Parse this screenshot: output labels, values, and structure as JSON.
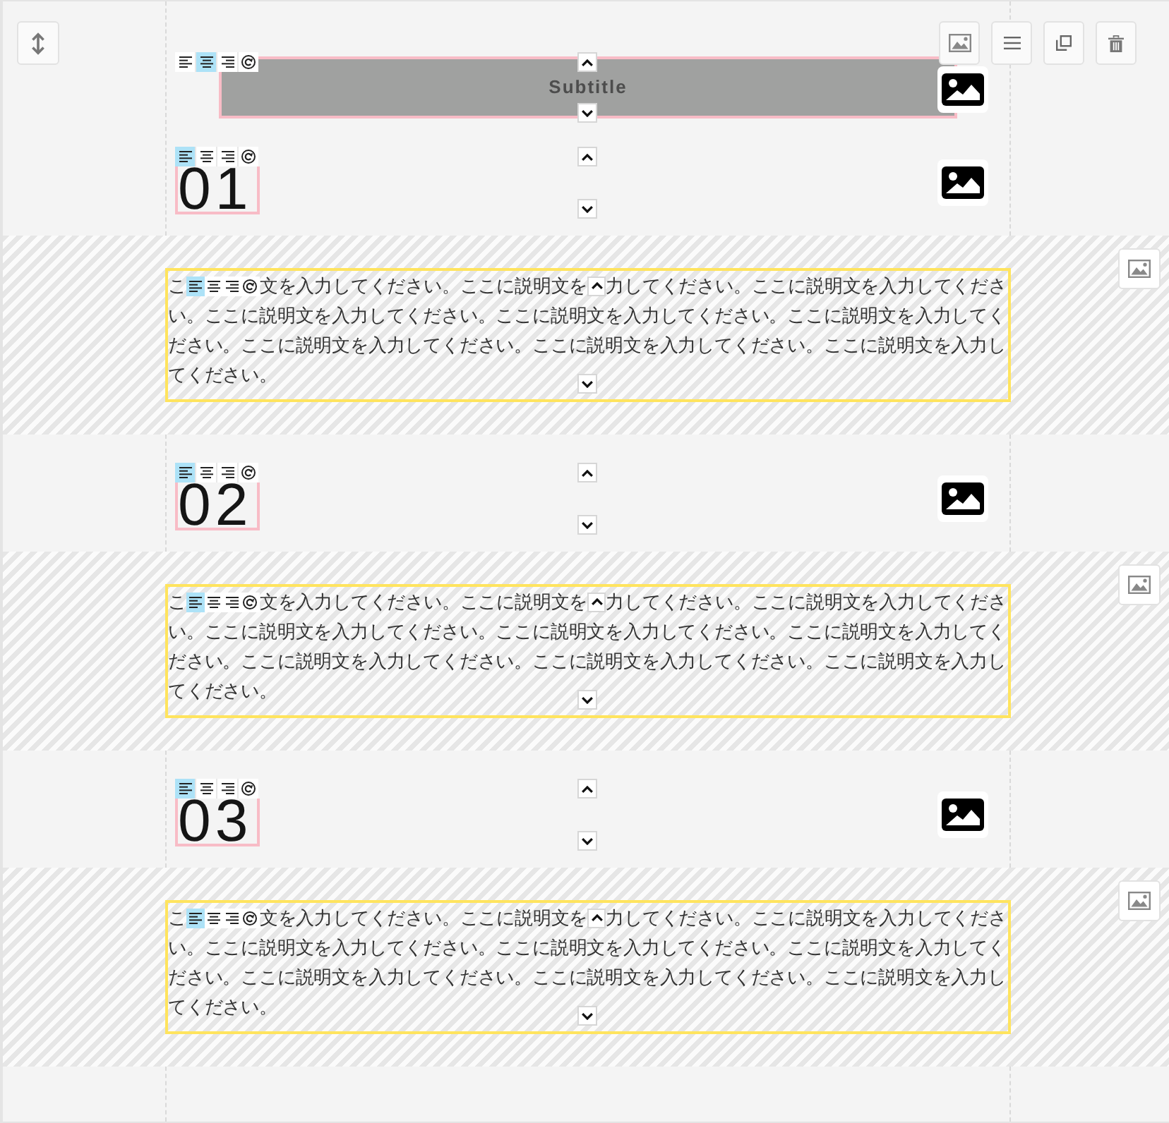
{
  "blocks": [
    {
      "kind": "subtitle",
      "text": "Subtitle",
      "align_options": [
        {
          "kind": "left",
          "selected": false
        },
        {
          "kind": "center",
          "selected": true
        },
        {
          "kind": "right",
          "selected": false
        },
        {
          "kind": "reset",
          "selected": false
        }
      ]
    },
    {
      "kind": "number",
      "text": "01",
      "align_options": [
        {
          "kind": "left",
          "selected": true
        },
        {
          "kind": "center",
          "selected": false
        },
        {
          "kind": "right",
          "selected": false
        },
        {
          "kind": "reset",
          "selected": false
        }
      ]
    },
    {
      "kind": "description",
      "first_line_parts": [
        "こ",
        "文を入力してください。ここに説明文を",
        "力してください。ここに説明文を入力してくださ"
      ],
      "more_lines": [
        "い。ここに説明文を入力してください。ここに説明文を入力してください。ここに説明文を入力してく",
        "ださい。ここに説明文を入力してください。ここに説明文を入力してください。ここに説明文を入力し",
        "てください。"
      ],
      "align_options": [
        {
          "kind": "left",
          "selected": true
        },
        {
          "kind": "center",
          "selected": false
        },
        {
          "kind": "right",
          "selected": false
        },
        {
          "kind": "reset",
          "selected": false
        }
      ]
    },
    {
      "kind": "number",
      "text": "02",
      "align_options": [
        {
          "kind": "left",
          "selected": true
        },
        {
          "kind": "center",
          "selected": false
        },
        {
          "kind": "right",
          "selected": false
        },
        {
          "kind": "reset",
          "selected": false
        }
      ]
    },
    {
      "kind": "description",
      "first_line_parts": [
        "こ",
        "文を入力してください。ここに説明文を",
        "力してください。ここに説明文を入力してくださ"
      ],
      "more_lines": [
        "い。ここに説明文を入力してください。ここに説明文を入力してください。ここに説明文を入力してく",
        "ださい。ここに説明文を入力してください。ここに説明文を入力してください。ここに説明文を入力し",
        "てください。"
      ],
      "align_options": [
        {
          "kind": "left",
          "selected": true
        },
        {
          "kind": "center",
          "selected": false
        },
        {
          "kind": "right",
          "selected": false
        },
        {
          "kind": "reset",
          "selected": false
        }
      ]
    },
    {
      "kind": "number",
      "text": "03",
      "align_options": [
        {
          "kind": "left",
          "selected": true
        },
        {
          "kind": "center",
          "selected": false
        },
        {
          "kind": "right",
          "selected": false
        },
        {
          "kind": "reset",
          "selected": false
        }
      ]
    },
    {
      "kind": "description",
      "first_line_parts": [
        "こ",
        "文を入力してください。ここに説明文を",
        "力してください。ここに説明文を入力してくださ"
      ],
      "more_lines": [
        "い。ここに説明文を入力してください。ここに説明文を入力してください。ここに説明文を入力してく",
        "ださい。ここに説明文を入力してください。ここに説明文を入力してください。ここに説明文を入力し",
        "てください。"
      ],
      "align_options": [
        {
          "kind": "left",
          "selected": true
        },
        {
          "kind": "center",
          "selected": false
        },
        {
          "kind": "right",
          "selected": false
        },
        {
          "kind": "reset",
          "selected": false
        }
      ]
    }
  ]
}
